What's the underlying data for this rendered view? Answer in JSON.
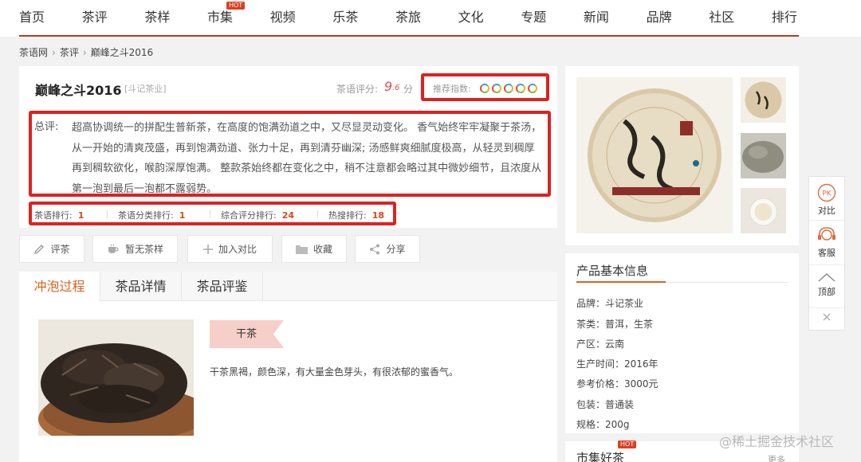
{
  "nav": {
    "items": [
      "首页",
      "茶评",
      "茶样",
      "市集",
      "视频",
      "乐茶",
      "茶旅",
      "文化",
      "专题",
      "新闻",
      "品牌",
      "社区",
      "排行"
    ],
    "hot_badge": "HOT"
  },
  "breadcrumb": [
    "茶语网",
    "茶评",
    "巅峰之斗2016"
  ],
  "product": {
    "name": "巅峰之斗2016",
    "brand_tag": "[斗记茶业]",
    "score_label": "茶语评分:",
    "score_int": "9",
    "score_dec": ".6",
    "score_unit": "分",
    "recommend_label": "推荐指数:",
    "recommend_rating": 5,
    "summary_label": "总评:",
    "summary": "超高协调统一的拼配生普新茶，在高度的饱满劲道之中，又尽显灵动变化。 香气始终牢牢凝聚于茶汤，从一开始的清爽茂盛，再到饱满劲道、张力十足，再到清芬幽深; 汤感鲜爽细腻度极高，从轻灵到稠厚再到稠软欲化，喉韵深厚饱满。 整款茶始终都在变化之中，稍不注意都会略过其中微妙细节，且浓度从第一泡到最后一泡都不露弱势。",
    "ranks": [
      {
        "label": "茶语排行:",
        "value": "1"
      },
      {
        "label": "茶语分类排行:",
        "value": "1"
      },
      {
        "label": "综合评分排行:",
        "value": "24"
      },
      {
        "label": "热搜排行:",
        "value": "18"
      }
    ]
  },
  "actions": [
    "评茶",
    "暂无茶样",
    "加入对比",
    "收藏",
    "分享"
  ],
  "tabs": [
    "冲泡过程",
    "茶品详情",
    "茶品评鉴"
  ],
  "brew": {
    "step_label": "干茶",
    "step_desc": "干茶黑褐，颜色深，有大量金色芽头，有很浓郁的蜜香气。"
  },
  "info": {
    "title": "产品基本信息",
    "rows": [
      "品牌：斗记茶业",
      "茶类：普洱，生茶",
      "产区：云南",
      "生产时间：2016年",
      "参考价格：3000元",
      "包装：普通装",
      "规格：200g"
    ]
  },
  "market": {
    "title": "市集好茶",
    "hot": "HOT",
    "more": "更多"
  },
  "side": {
    "compare_icon_text": "PK",
    "compare": "对比",
    "service": "客服",
    "top": "顶部"
  },
  "watermark": "@稀土掘金技术社区",
  "colors": {
    "accent": "#d86320",
    "nav_line": "#b73a1c",
    "highlight_box": "#e02020",
    "rank_value": "#d34a1f"
  }
}
